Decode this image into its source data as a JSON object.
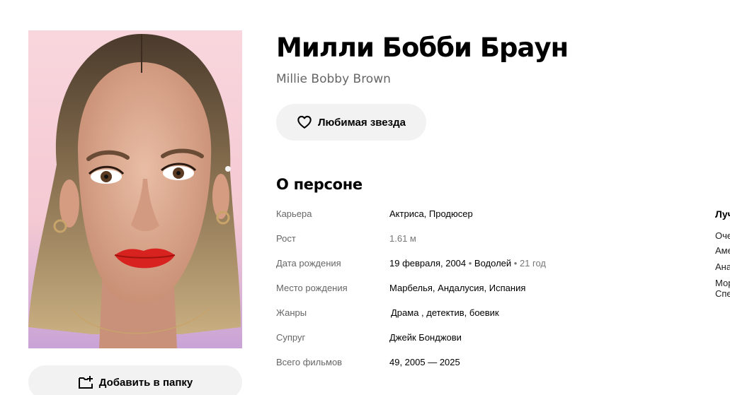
{
  "person": {
    "name": "Милли Бобби Браун",
    "original_name": "Millie Bobby Brown"
  },
  "actions": {
    "favorite_label": "Любимая звезда",
    "add_to_folder_label": "Добавить в папку"
  },
  "about": {
    "section_title": "О персоне",
    "rows": [
      {
        "label": "Карьера",
        "value": "Актриса, Продюсер"
      },
      {
        "label": "Рост",
        "value": "1.61 м"
      },
      {
        "label": "Дата рождения",
        "date": "19 февраля, 2004",
        "sep1": " • ",
        "zodiac": "Водолей",
        "sep2": " • ",
        "age": "21 год"
      },
      {
        "label": "Место рождения",
        "value": "Марбелья, Андалусия, Испания"
      },
      {
        "label": "Жанры",
        "value": "Драма , детектив, боевик"
      },
      {
        "label": "Супруг",
        "value": "Джейк Бонджови"
      },
      {
        "label": "Всего фильмов",
        "value": "49, 2005 — 2025"
      }
    ]
  },
  "side_column": {
    "title": "Луч",
    "items": [
      "Оче",
      "Аме",
      "Ана",
      "Мор",
      "Спе"
    ]
  },
  "icons": {
    "favorite": "heart-outline-icon",
    "folder": "folder-add-icon"
  }
}
